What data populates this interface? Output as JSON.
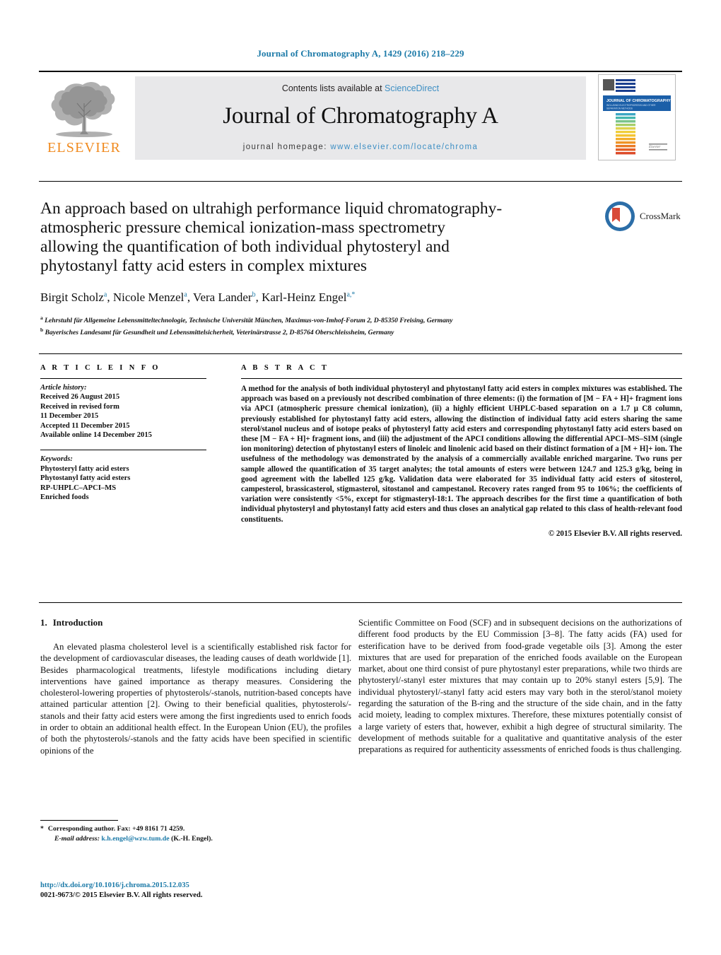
{
  "running_head": "Journal of Chromatography A, 1429 (2016) 218–229",
  "masthead": {
    "publisher_name": "ELSEVIER",
    "contents_prefix": "Contents lists available at ",
    "contents_link": "ScienceDirect",
    "journal_title": "Journal of Chromatography A",
    "homepage_prefix": "journal homepage: ",
    "homepage_url": "www.elsevier.com/locate/chroma",
    "cover_title": "JOURNAL OF CHROMATOGRAPHY A",
    "cover_subtitle": "INCLUDING ELECTROPHORESIS AND OTHER SEPARATION METHODS"
  },
  "article": {
    "title": "An approach based on ultrahigh performance liquid chromatography-atmospheric pressure chemical ionization-mass spectrometry allowing the quantification of both individual phytosteryl and phytostanyl fatty acid esters in complex mixtures",
    "crossmark_label": "CrossMark",
    "authors": [
      {
        "name": "Birgit Scholz",
        "marks": "a"
      },
      {
        "name": "Nicole Menzel",
        "marks": "a"
      },
      {
        "name": "Vera Lander",
        "marks": "b"
      },
      {
        "name": "Karl-Heinz Engel",
        "marks": "a,*"
      }
    ],
    "affiliations": [
      {
        "mark": "a",
        "text": "Lehrstuhl für Allgemeine Lebensmitteltechnologie, Technische Universität München, Maximus-von-Imhof-Forum 2, D-85350 Freising, Germany"
      },
      {
        "mark": "b",
        "text": "Bayerisches Landesamt für Gesundheit und Lebensmittelsicherheit, Veterinärstrasse 2, D-85764 Oberschleissheim, Germany"
      }
    ]
  },
  "info": {
    "heading": "A R T I C L E    I N F O",
    "history_label": "Article history:",
    "history": [
      "Received 26 August 2015",
      "Received in revised form",
      "11 December 2015",
      "Accepted 11 December 2015",
      "Available online 14 December 2015"
    ],
    "keywords_label": "Keywords:",
    "keywords": [
      "Phytosteryl fatty acid esters",
      "Phytostanyl fatty acid esters",
      "RP-UHPLC–APCI–MS",
      "Enriched foods"
    ]
  },
  "abstract": {
    "heading": "A B S T R A C T",
    "text": "A method for the analysis of both individual phytosteryl and phytostanyl fatty acid esters in complex mixtures was established. The approach was based on a previously not described combination of three elements: (i) the formation of [M − FA + H]+ fragment ions via APCI (atmospheric pressure chemical ionization), (ii) a highly efficient UHPLC-based separation on a 1.7 μ C8 column, previously established for phytostanyl fatty acid esters, allowing the distinction of individual fatty acid esters sharing the same sterol/stanol nucleus and of isotope peaks of phytosteryl fatty acid esters and corresponding phytostanyl fatty acid esters based on these [M − FA + H]+ fragment ions, and (iii) the adjustment of the APCI conditions allowing the differential APCI–MS–SIM (single ion monitoring) detection of phytostanyl esters of linoleic and linolenic acid based on their distinct formation of a [M + H]+ ion. The usefulness of the methodology was demonstrated by the analysis of a commercially available enriched margarine. Two runs per sample allowed the quantification of 35 target analytes; the total amounts of esters were between 124.7 and 125.3 g/kg, being in good agreement with the labelled 125 g/kg. Validation data were elaborated for 35 individual fatty acid esters of sitosterol, campesterol, brassicasterol, stigmasterol, sitostanol and campestanol. Recovery rates ranged from 95 to 106%; the coefficients of variation were consistently <5%, except for stigmasteryl-18:1. The approach describes for the first time a quantification of both individual phytosteryl and phytostanyl fatty acid esters and thus closes an analytical gap related to this class of health-relevant food constituents.",
    "copyright": "© 2015 Elsevier B.V. All rights reserved."
  },
  "introduction": {
    "number": "1.",
    "title": "Introduction",
    "left_paragraph": "An elevated plasma cholesterol level is a scientifically established risk factor for the development of cardiovascular diseases, the leading causes of death worldwide [1]. Besides pharmacological treatments, lifestyle modifications including dietary interventions have gained importance as therapy measures. Considering the cholesterol-lowering properties of phytosterols/-stanols, nutrition-based concepts have attained particular attention [2]. Owing to their beneficial qualities, phytosterols/-stanols and their fatty acid esters were among the first ingredients used to enrich foods in order to obtain an additional health effect. In the European Union (EU), the profiles of both the phytosterols/-stanols and the fatty acids have been specified in scientific opinions of the",
    "right_paragraph": "Scientific Committee on Food (SCF) and in subsequent decisions on the authorizations of different food products by the EU Commission [3–8]. The fatty acids (FA) used for esterification have to be derived from food-grade vegetable oils [3]. Among the ester mixtures that are used for preparation of the enriched foods available on the European market, about one third consist of pure phytostanyl ester preparations, while two thirds are phytosteryl/-stanyl ester mixtures that may contain up to 20% stanyl esters [5,9]. The individual phytosteryl/-stanyl fatty acid esters may vary both in the sterol/stanol moiety regarding the saturation of the B-ring and the structure of the side chain, and in the fatty acid moiety, leading to complex mixtures. Therefore, these mixtures potentially consist of a large variety of esters that, however, exhibit a high degree of structural similarity. The development of methods suitable for a qualitative and quantitative analysis of the ester preparations as required for authenticity assessments of enriched foods is thus challenging."
  },
  "footnote": {
    "corresponding": "Corresponding author. Fax: +49 8161 71 4259.",
    "email_label": "E-mail address:",
    "email": "k.h.engel@wzw.tum.de",
    "email_suffix": "(K.-H. Engel)."
  },
  "footer": {
    "doi": "http://dx.doi.org/10.1016/j.chroma.2015.12.035",
    "issn": "0021-9673/© 2015 Elsevier B.V. All rights reserved."
  },
  "colors": {
    "link_blue": "#1c7aa8",
    "sciencedirect_blue": "#3e8fc4",
    "elsevier_orange": "#f08a1e",
    "masthead_grey": "#e8e8ea"
  }
}
